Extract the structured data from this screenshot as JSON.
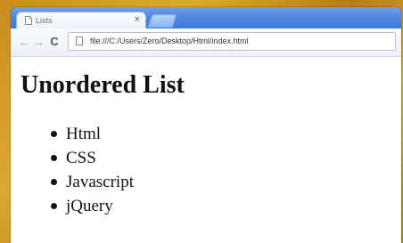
{
  "browser": {
    "tab_title": "Lists",
    "tab_close": "×",
    "address": "file:///C:/Users/Zero/Desktop/Html/index.html",
    "back_icon": "←",
    "forward_icon": "→",
    "reload_icon": "C"
  },
  "page": {
    "heading": "Unordered List",
    "items": [
      "Html",
      "CSS",
      "Javascript",
      "jQuery"
    ]
  },
  "colors": {
    "frame_gold": "#c98d1d",
    "tabstrip_blue": "#4d88df",
    "page_background": "#ffffff",
    "text": "#111111"
  },
  "icons": {
    "tab_page": "page-icon",
    "new_tab": "new-tab-icon",
    "address_page": "page-icon",
    "list_bullet": "bullet-icon"
  }
}
